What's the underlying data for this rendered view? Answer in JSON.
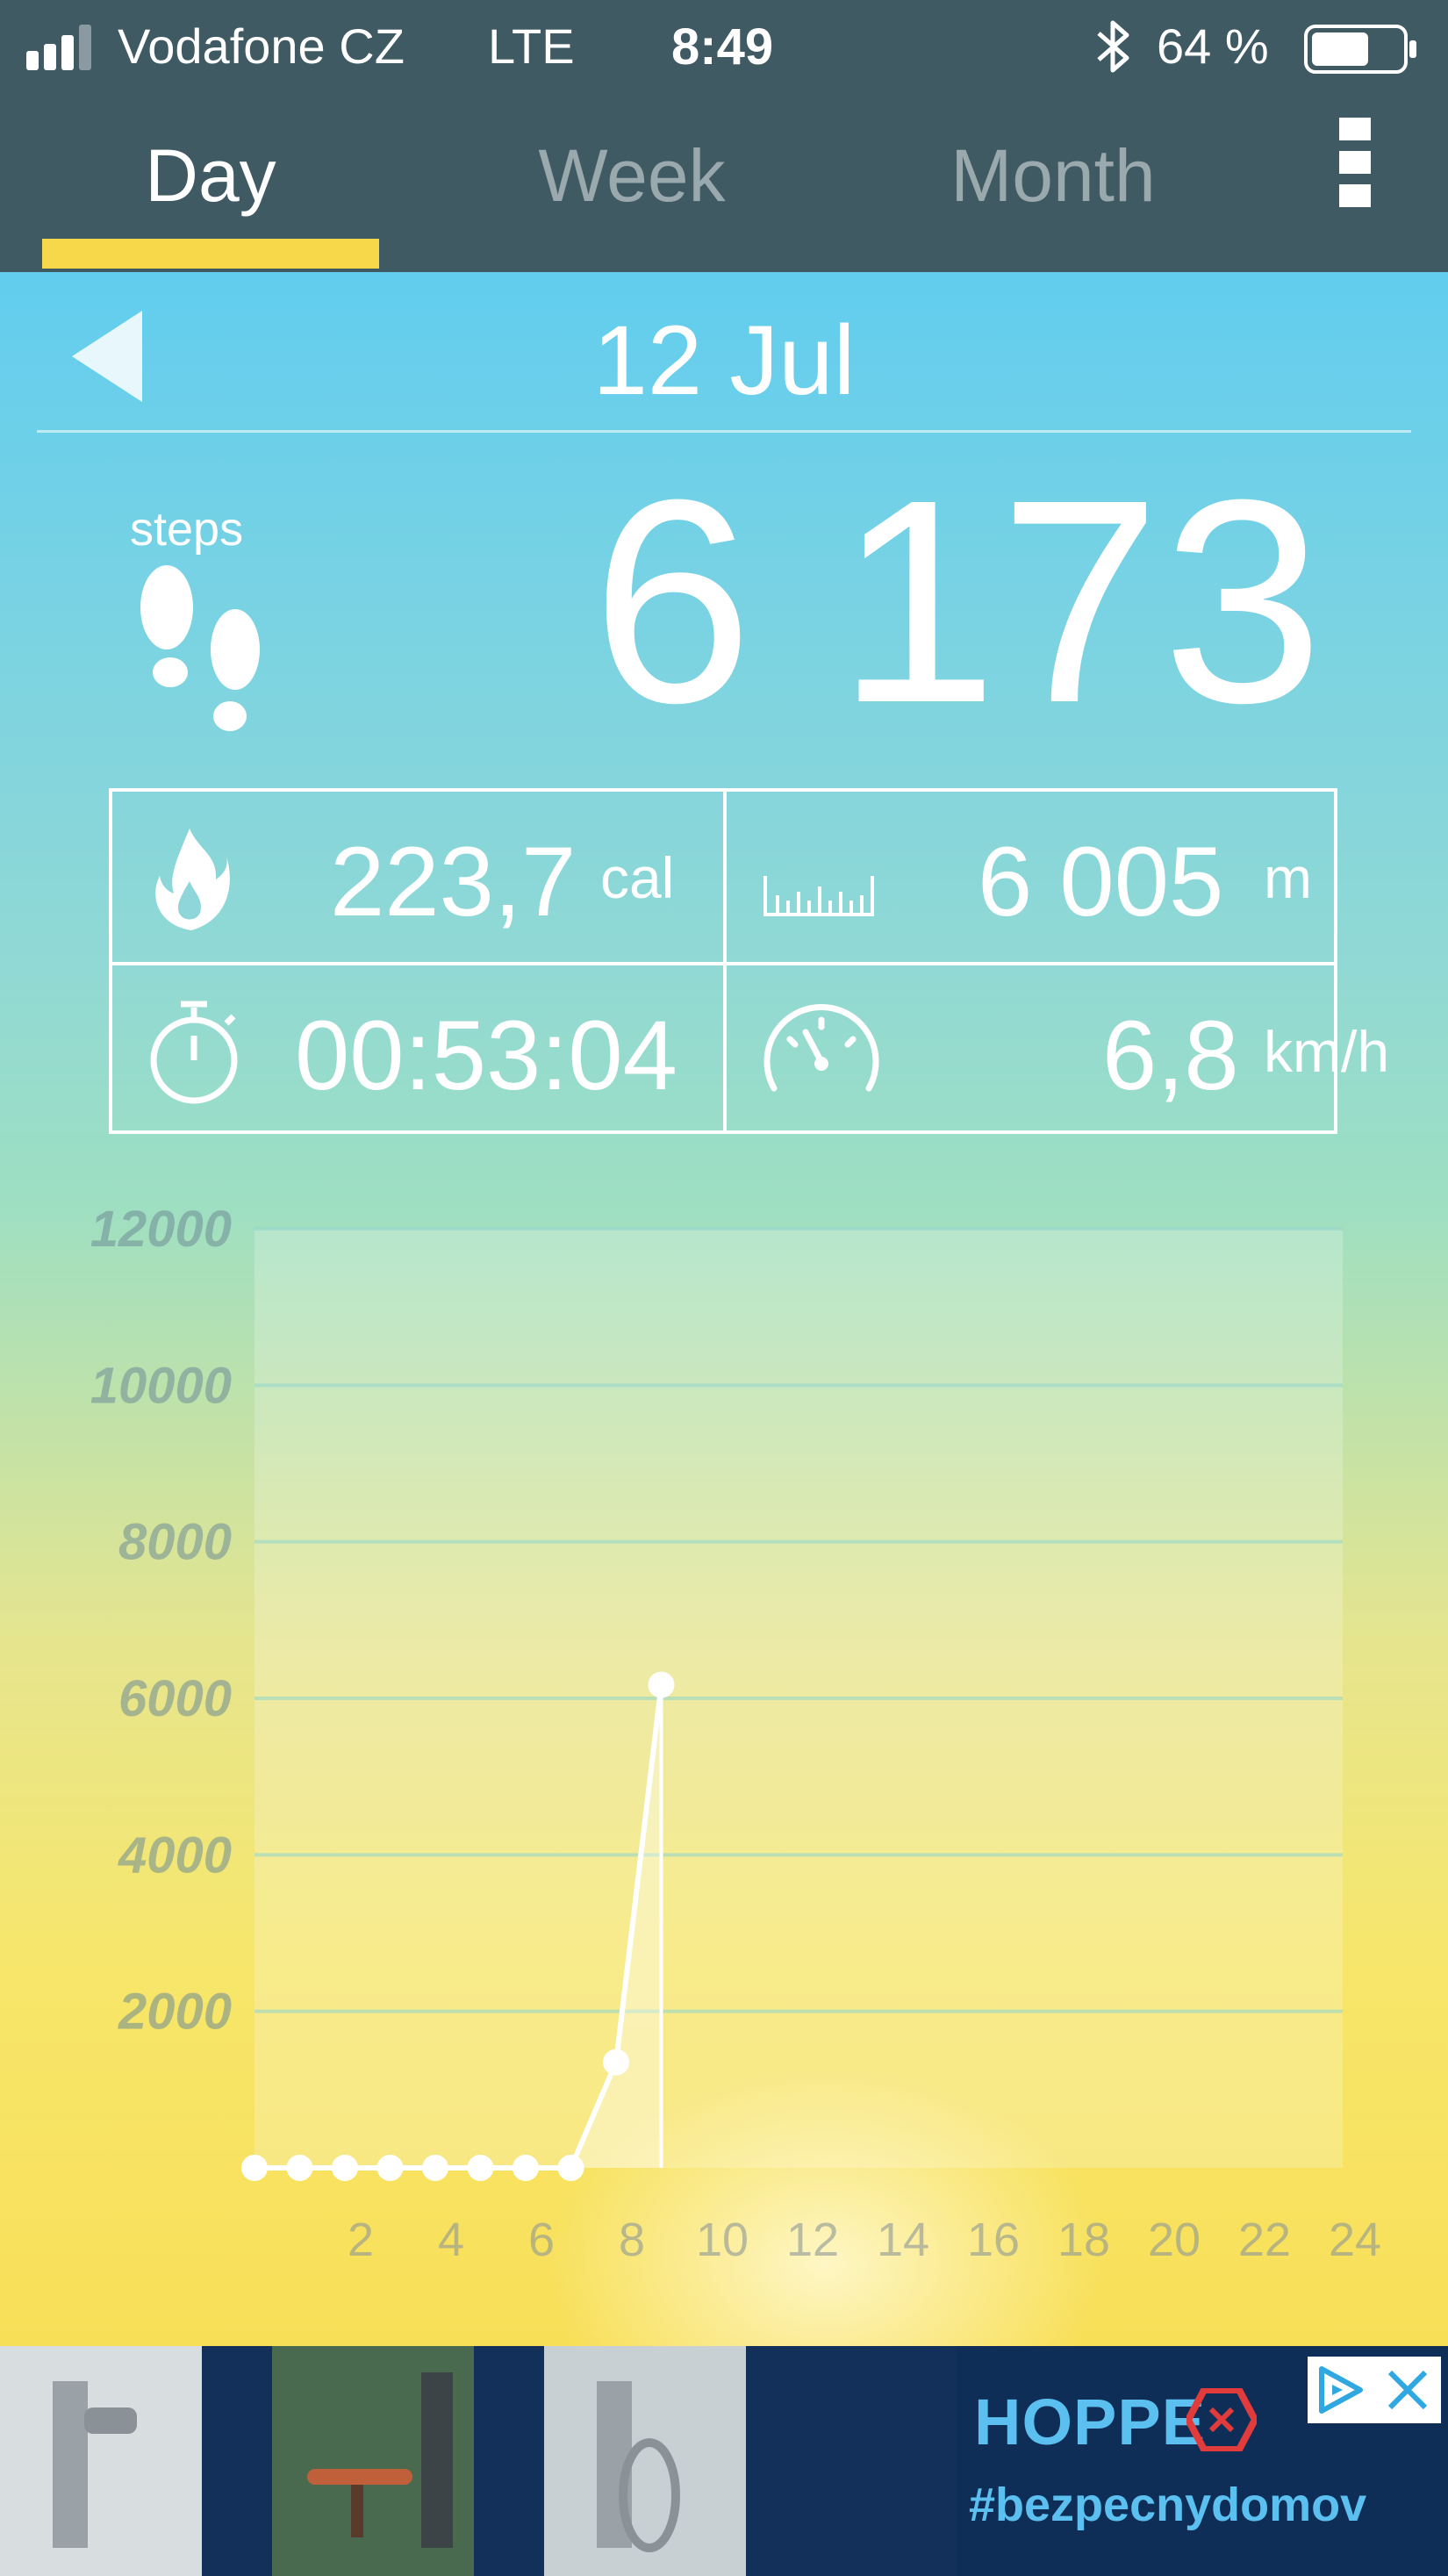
{
  "status_bar": {
    "carrier": "Vodafone CZ",
    "network": "LTE",
    "time": "8:49",
    "battery_percent": "64 %",
    "battery_level": 0.64
  },
  "tabs": [
    {
      "label": "Day",
      "active": true
    },
    {
      "label": "Week",
      "active": false
    },
    {
      "label": "Month",
      "active": false
    }
  ],
  "day": {
    "date": "12 Jul",
    "steps_label": "steps",
    "steps_value": "6 173"
  },
  "stats": {
    "calories_value": "223,7",
    "calories_unit": "cal",
    "distance_value": "6 005",
    "distance_unit": "m",
    "duration_value": "00:53:04",
    "speed_value": "6,8",
    "speed_unit": "km/h"
  },
  "chart_data": {
    "type": "line",
    "x": [
      0,
      1,
      2,
      3,
      4,
      5,
      6,
      7,
      8,
      9
    ],
    "y": [
      0,
      0,
      0,
      0,
      0,
      0,
      0,
      0,
      1350,
      6173
    ],
    "xticks": [
      "2",
      "4",
      "6",
      "8",
      "10",
      "12",
      "14",
      "16",
      "18",
      "20",
      "22",
      "24"
    ],
    "yticks": [
      "2000",
      "4000",
      "6000",
      "8000",
      "10000",
      "12000"
    ],
    "xlim": [
      0,
      24
    ],
    "ylim": [
      0,
      12000
    ],
    "grid": true
  },
  "ad": {
    "brand": "HOPPE",
    "tagline": "#bezpecnydomov"
  },
  "colors": {
    "header_bg": "#3f5a62",
    "tab_active_underline": "#f7d84a",
    "ad_bg": "#0f2e57",
    "ad_text": "#5bc0f0"
  }
}
